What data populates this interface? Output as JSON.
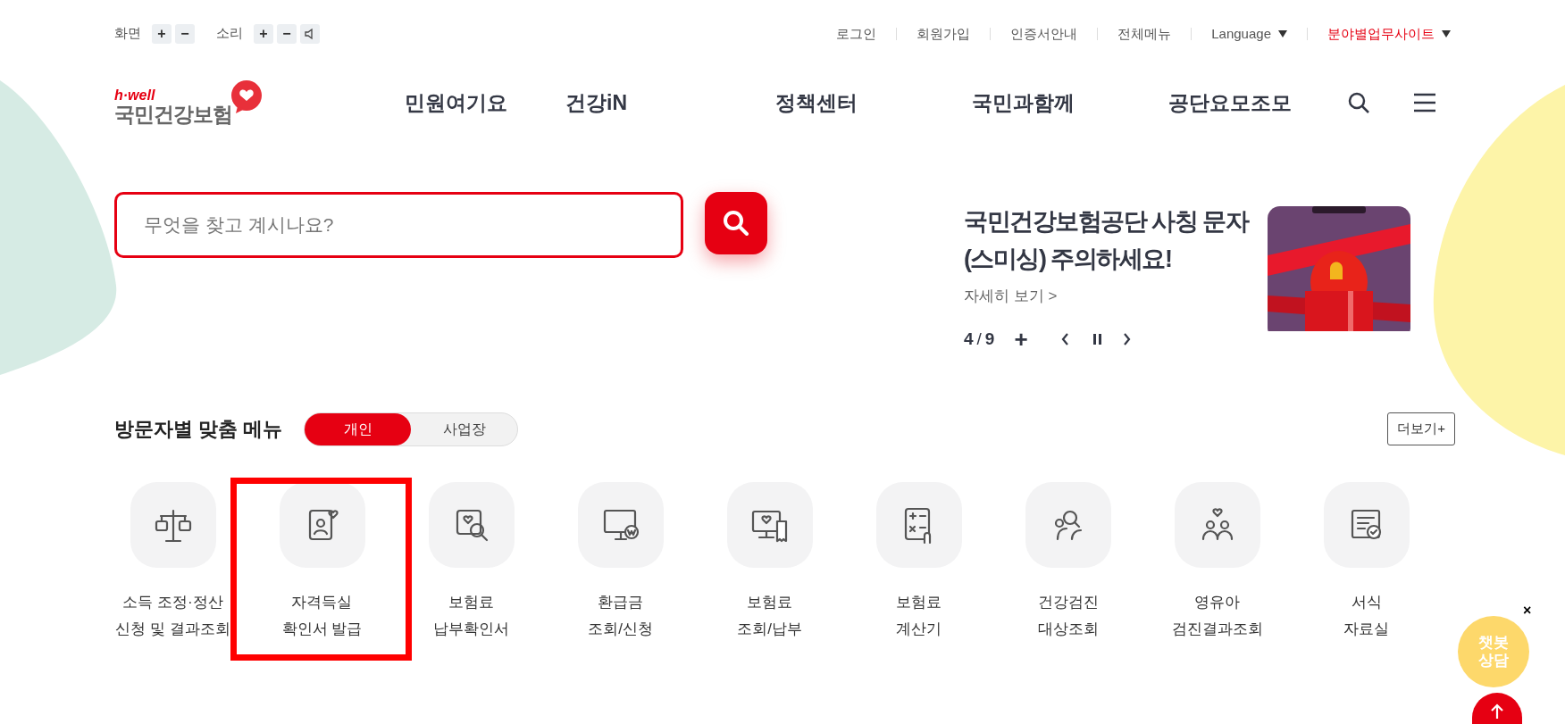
{
  "zoom": {
    "label": "화면",
    "buttons": [
      "+",
      "−"
    ]
  },
  "sound": {
    "label": "소리",
    "buttons": [
      "+",
      "−"
    ]
  },
  "util_links": [
    {
      "label": "로그인",
      "kind": "link"
    },
    {
      "label": "회원가입",
      "kind": "link"
    },
    {
      "label": "인증서안내",
      "kind": "link"
    },
    {
      "label": "전체메뉴",
      "kind": "link"
    },
    {
      "label": "Language",
      "kind": "dropdown"
    },
    {
      "label": "분야별업무사이트",
      "kind": "dropdown",
      "color": "#e60012"
    }
  ],
  "logo": {
    "tagline": "h·well",
    "name": "국민건강보험"
  },
  "nav": [
    "민원여기요",
    "건강iN",
    "정책센터",
    "국민과함께",
    "공단요모조모"
  ],
  "search": {
    "placeholder": "무엇을 찾고 계시나요?"
  },
  "banner": {
    "title": [
      "국민건강보험공단 사칭 문자",
      "(스미싱) 주의하세요!"
    ],
    "link": "자세히 보기 >",
    "current": "4",
    "separator": "/",
    "total": "9",
    "add": "+"
  },
  "custom_menu": {
    "title": "방문자별 맞춤 메뉴",
    "tabs": [
      {
        "label": "개인",
        "selected": true
      },
      {
        "label": "사업장",
        "selected": false
      }
    ],
    "more": "더보기+",
    "items": [
      {
        "label": [
          "소득 조정·정산",
          "신청 및 결과조회"
        ],
        "highlighted": false
      },
      {
        "label": [
          "자격득실",
          "확인서 발급"
        ],
        "highlighted": true
      },
      {
        "label": [
          "보험료",
          "납부확인서"
        ],
        "highlighted": false
      },
      {
        "label": [
          "환급금",
          "조회/신청"
        ],
        "highlighted": false
      },
      {
        "label": [
          "보험료",
          "조회/납부"
        ],
        "highlighted": false
      },
      {
        "label": [
          "보험료",
          "계산기"
        ],
        "highlighted": false
      },
      {
        "label": [
          "건강검진",
          "대상조회"
        ],
        "highlighted": false
      },
      {
        "label": [
          "영유아",
          "검진결과조회"
        ],
        "highlighted": false
      },
      {
        "label": [
          "서식",
          "자료실"
        ],
        "highlighted": false
      }
    ]
  },
  "chatbot": {
    "label": [
      "챗봇",
      "상담"
    ],
    "close": "×"
  }
}
